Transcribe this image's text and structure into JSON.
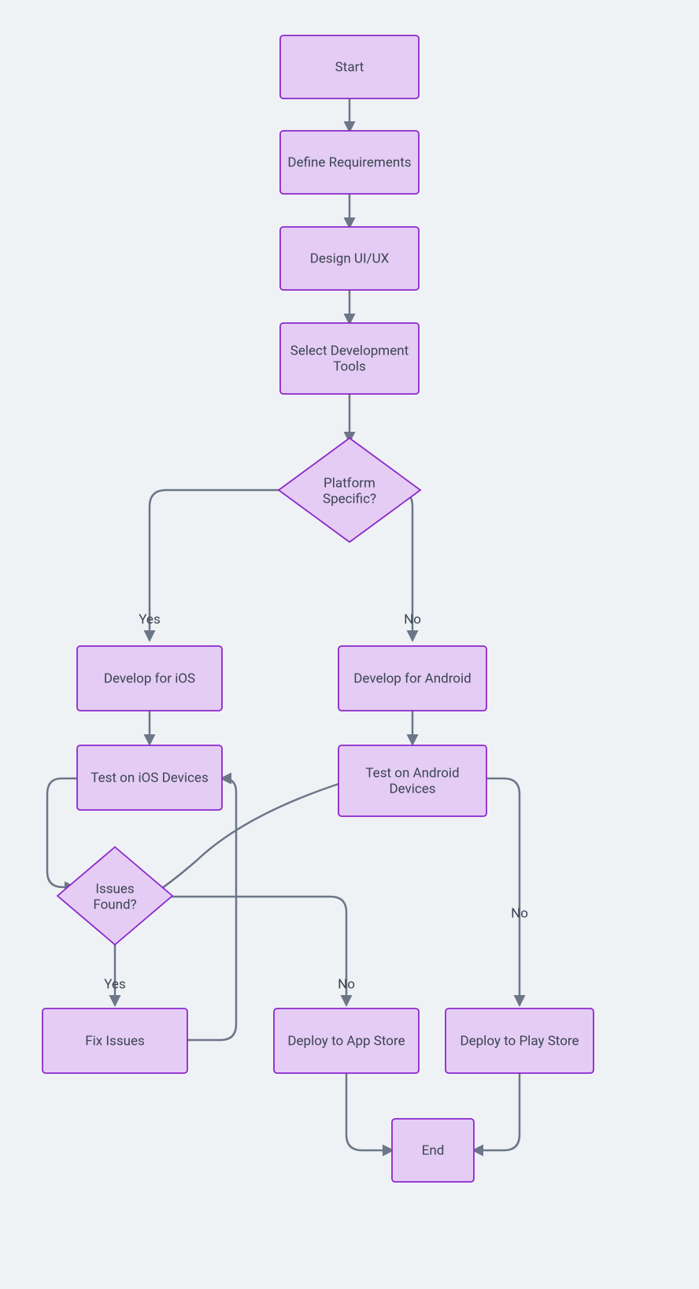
{
  "colors": {
    "node_fill": "#e4ccf4",
    "node_stroke": "#8c28cc",
    "edge": "#6b7687",
    "text": "#3b4452",
    "bg": "#eff2f5"
  },
  "nodes": {
    "start": "Start",
    "define": "Define Requirements",
    "design": "Design UI/UX",
    "select": [
      "Select Development",
      "Tools"
    ],
    "platform": [
      "Platform",
      "Specific?"
    ],
    "ios": "Develop for iOS",
    "android": "Develop for Android",
    "testios": "Test on iOS Devices",
    "testandroid": [
      "Test on Android",
      "Devices"
    ],
    "issues": [
      "Issues",
      "Found?"
    ],
    "fix": "Fix Issues",
    "deployapp": "Deploy to App Store",
    "deployplay": "Deploy to Play Store",
    "end": "End"
  },
  "edges": {
    "yes_left": "Yes",
    "no_right": "No",
    "issues_yes": "Yes",
    "issues_no": "No",
    "testandroid_no": "No"
  }
}
